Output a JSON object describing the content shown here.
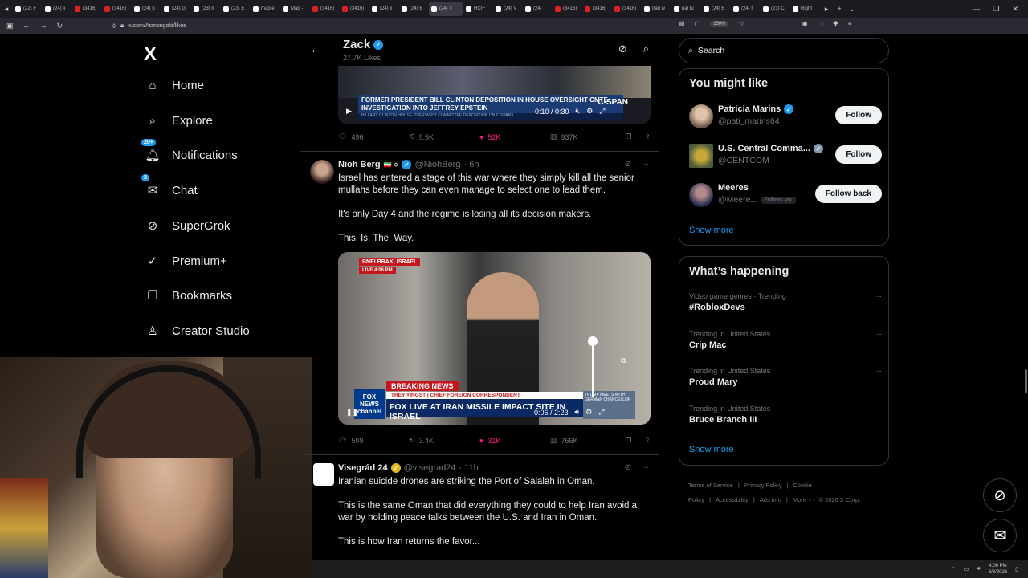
{
  "browser": {
    "tabs": [
      {
        "label": "(22) F",
        "color": "#fff"
      },
      {
        "label": "(24) li",
        "color": "#fff"
      },
      {
        "label": "(3416)",
        "color": "#e02020"
      },
      {
        "label": "(3416)",
        "color": "#e02020"
      },
      {
        "label": "(24) p",
        "color": "#fff"
      },
      {
        "label": "(24) G",
        "color": "#fff"
      },
      {
        "label": "(23) li",
        "color": "#fff"
      },
      {
        "label": "(23) E",
        "color": "#fff"
      },
      {
        "label": "map e",
        "color": "#fff"
      },
      {
        "label": "Map -",
        "color": "#fff"
      },
      {
        "label": "(3416)",
        "color": "#e02020"
      },
      {
        "label": "(3416)",
        "color": "#e02020"
      },
      {
        "label": "(24) li",
        "color": "#fff"
      },
      {
        "label": "(24) E",
        "color": "#fff"
      },
      {
        "label": "(24) ×",
        "color": "#fff",
        "active": true
      },
      {
        "label": "HCrF",
        "color": "#fff"
      },
      {
        "label": "(24) V",
        "color": "#fff"
      },
      {
        "label": "(24)",
        "color": "#fff"
      },
      {
        "label": "(3416)",
        "color": "#e02020"
      },
      {
        "label": "(3416)",
        "color": "#e02020"
      },
      {
        "label": "(3416)",
        "color": "#e02020"
      },
      {
        "label": "iran w",
        "color": "#fff"
      },
      {
        "label": "rial tu",
        "color": "#fff"
      },
      {
        "label": "(24) E",
        "color": "#fff"
      },
      {
        "label": "(24) fi",
        "color": "#fff"
      },
      {
        "label": "(23) C",
        "color": "#fff"
      },
      {
        "label": "Right",
        "color": "#fff"
      }
    ],
    "url": "x.com/Asmongold/likes",
    "zoom": "150%"
  },
  "sidebar": {
    "logo": "X",
    "items": [
      {
        "label": "Home",
        "icon": "home-icon",
        "glyph": "⌂"
      },
      {
        "label": "Explore",
        "icon": "search-icon",
        "glyph": "⌕"
      },
      {
        "label": "Notifications",
        "icon": "bell-icon",
        "glyph": "🔔︎",
        "badge": "20+"
      },
      {
        "label": "Chat",
        "icon": "mail-icon",
        "glyph": "✉",
        "badge": "3"
      },
      {
        "label": "SuperGrok",
        "icon": "grok-icon",
        "glyph": "⊘"
      },
      {
        "label": "Premium+",
        "icon": "verified-icon",
        "glyph": "✓"
      },
      {
        "label": "Bookmarks",
        "icon": "bookmark-icon",
        "glyph": "❐"
      },
      {
        "label": "Creator Studio",
        "icon": "creator-icon",
        "glyph": "♙"
      }
    ]
  },
  "header": {
    "name": "Zack",
    "likes": "27.7K Likes"
  },
  "tweets": [
    {
      "video_chyron": "FORMER PRESIDENT BILL CLINTON DEPOSITION IN HOUSE OVERSIGHT CMTE. INVESTIGATION INTO JEFFREY EPSTEIN",
      "video_subchyron": "HILLARY CLINTON HOUSE OVERSIGHT COMMITTEE DEPOSITION ON C-SPAN3",
      "video_channel": "C-SPAN",
      "video_time": "0:10 / 0:30",
      "replies": "496",
      "reposts": "9.5K",
      "likes": "52K",
      "views": "937K"
    },
    {
      "name": "Nioh Berg",
      "flags": "🇮🇷 ✡",
      "handle": "@NiohBerg",
      "time": "· 6h",
      "text1": "Israel has entered a stage of this war where they simply kill all the senior mullahs before they can even manage to select one to lead them.",
      "text2": "It's only Day 4 and the regime is losing all its decision makers.",
      "text3": "This. Is. The. Way.",
      "video_location": "BNEI BRAK, ISRAEL",
      "video_live": "LIVE  4:06 PM",
      "video_breaking": "BREAKING NEWS",
      "video_correspondent": "TREY YINGST | CHIEF FOREIGN CORRESPONDENT",
      "video_headline": "FOX LIVE AT IRAN MISSILE IMPACT SITE IN ISRAEL",
      "video_channel": "FOX NEWS channel",
      "video_inset": "TRUMP MEETS WITH GERMAN CHANCELLOR",
      "video_time": "0:06 / 2:23",
      "replies": "509",
      "reposts": "3.4K",
      "likes": "31K",
      "views": "766K"
    },
    {
      "name": "Visegrád 24",
      "handle": "@visegrad24",
      "time": "· 11h",
      "text1": "Iranian suicide drones are striking the Port of Salalah in Oman.",
      "text2": "This is the same Oman that did everything they could to help Iran avoid a war by holding peace talks between the U.S. and Iran in Oman.",
      "text3": "This is how Iran returns the favor..."
    }
  ],
  "search": {
    "placeholder": "Search"
  },
  "might_like": {
    "title": "You might like",
    "users": [
      {
        "name": "Patricia Marins",
        "handle": "@pati_marins64",
        "button": "Follow",
        "badge": "blue"
      },
      {
        "name": "U.S. Central Comma...",
        "handle": "@CENTCOM",
        "button": "Follow",
        "badge": "gray"
      },
      {
        "name": "Meeres",
        "handle": "@Meere...",
        "follows_you": "Follows you",
        "button": "Follow back"
      }
    ],
    "show_more": "Show more"
  },
  "happening": {
    "title": "What’s happening",
    "trends": [
      {
        "meta": "Video game genres · Trending",
        "title": "#RobloxDevs"
      },
      {
        "meta": "Trending in United States",
        "title": "Crip Mac"
      },
      {
        "meta": "Trending in United States",
        "title": "Proud Mary"
      },
      {
        "meta": "Trending in United States",
        "title": "Bruce Branch III"
      }
    ],
    "show_more": "Show more"
  },
  "footer": {
    "links": [
      "Terms of Service",
      "|",
      "Privacy Policy",
      "|",
      "Cookie Policy",
      "|",
      "Accessibility",
      "|",
      "Ads info",
      "|",
      "More ···",
      "© 2026 X Corp."
    ]
  },
  "taskbar": {
    "time": "4:06 PM",
    "date": "3/3/2026"
  },
  "colors": {
    "accent": "#1d9bf0",
    "like": "#f91880",
    "border": "#2f3336"
  }
}
